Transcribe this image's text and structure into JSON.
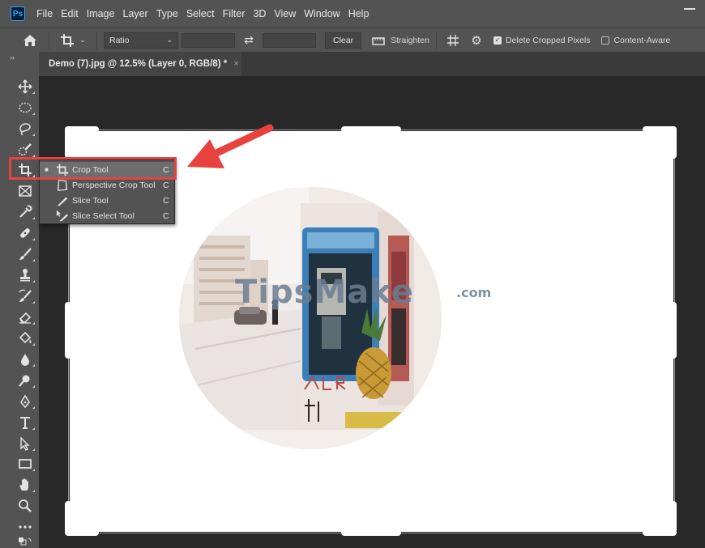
{
  "app": {
    "logo": "Ps"
  },
  "menu": [
    "File",
    "Edit",
    "Image",
    "Layer",
    "Type",
    "Select",
    "Filter",
    "3D",
    "View",
    "Window",
    "Help"
  ],
  "options_bar": {
    "ratio_label": "Ratio",
    "clear_label": "Clear",
    "straighten_label": "Straighten",
    "delete_cropped_label": "Delete Cropped Pixels",
    "delete_cropped_checked": true,
    "content_aware_label": "Content-Aware",
    "content_aware_checked": false
  },
  "document_tab": {
    "title": "Demo (7).jpg @ 12.5% (Layer 0, RGB/8) *",
    "close": "×"
  },
  "toolbar": {
    "collapse": "››",
    "tools": [
      "move-tool",
      "marquee-tool",
      "lasso-tool",
      "quick-select-tool",
      "crop-tool",
      "frame-tool",
      "eyedropper-tool",
      "healing-brush-tool",
      "brush-tool",
      "clone-stamp-tool",
      "history-brush-tool",
      "eraser-tool",
      "paint-bucket-tool",
      "blur-tool",
      "dodge-tool",
      "pen-tool",
      "type-tool",
      "path-select-tool",
      "rectangle-tool",
      "hand-tool",
      "zoom-tool",
      "more-tools"
    ]
  },
  "flyout": {
    "items": [
      {
        "label": "Crop Tool",
        "key": "C",
        "selected": true,
        "bullet": "■"
      },
      {
        "label": "Perspective Crop Tool",
        "key": "C",
        "selected": false,
        "bullet": ""
      },
      {
        "label": "Slice Tool",
        "key": "C",
        "selected": false,
        "bullet": ""
      },
      {
        "label": "Slice Select Tool",
        "key": "C",
        "selected": false,
        "bullet": ""
      }
    ]
  },
  "canvas": {
    "watermark": "TipsMake",
    "watermark_suffix": ".com"
  },
  "colors": {
    "annotation_red": "#e8423f",
    "canvas": "#ffffff",
    "panel": "#535353",
    "background": "#282828"
  }
}
